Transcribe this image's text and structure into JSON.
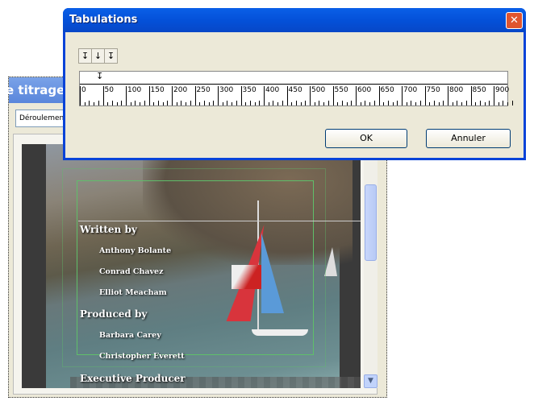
{
  "background_window": {
    "title": "e titrage .",
    "dropdown_value": "Déroulement"
  },
  "credits": [
    {
      "text": "Written by",
      "type": "heading"
    },
    {
      "text": "Anthony Bolante",
      "type": "name"
    },
    {
      "text": "Conrad Chavez",
      "type": "name"
    },
    {
      "text": "Elliot Meacham",
      "type": "name"
    },
    {
      "text": "Produced by",
      "type": "heading"
    },
    {
      "text": "Barbara Carey",
      "type": "name"
    },
    {
      "text": "Christopher Everett",
      "type": "name"
    },
    {
      "text": "Executive Producer",
      "type": "heading"
    }
  ],
  "dialog": {
    "title": "Tabulations",
    "close_icon": "close-icon",
    "tab_buttons": [
      {
        "glyph": "↧",
        "name": "left-tab"
      },
      {
        "glyph": "↓",
        "name": "center-tab"
      },
      {
        "glyph": "↧",
        "name": "right-tab"
      }
    ],
    "tab_marker": "↧",
    "ruler_labels": [
      "0",
      "50",
      "100",
      "150",
      "200",
      "250",
      "300",
      "350",
      "400",
      "450",
      "500",
      "550",
      "600",
      "650",
      "700",
      "750",
      "800",
      "850",
      "900"
    ],
    "ok": "OK",
    "cancel": "Annuler"
  },
  "colors": {
    "title_bar": "#0451d9",
    "close": "#e0552f",
    "safe_area": "#5fbf6a"
  }
}
